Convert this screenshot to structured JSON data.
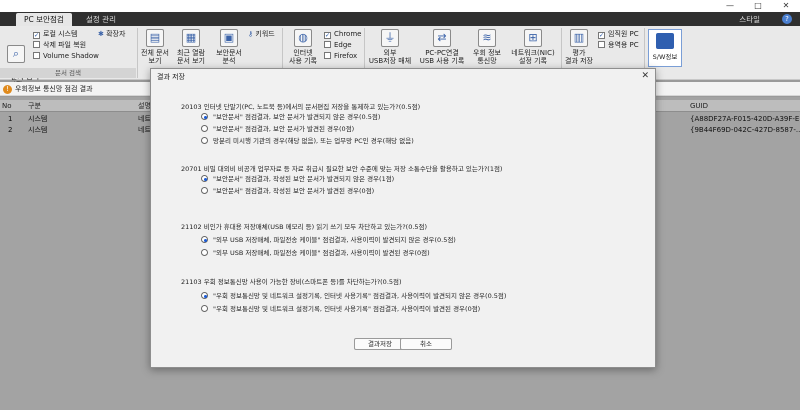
{
  "window": {
    "minimize": "—",
    "maximize": "□",
    "close": "✕"
  },
  "tabs": [
    {
      "label": "PC 보안점검"
    },
    {
      "label": "설정 관리"
    }
  ],
  "style_label": "스타일",
  "help_icon": "?",
  "ribbon": {
    "check_start": "문서 검색\n시작",
    "options": [
      {
        "label": "로컬 시스템",
        "checked": true
      },
      {
        "label": "삭제 파일 복원",
        "checked": false
      },
      {
        "label": "Volume Shadow",
        "checked": false
      }
    ],
    "extension": "확장자",
    "group_doc_search": "문서 검색",
    "full_doc": "전체 문서\n보기",
    "recent_doc": "최근 열람\n문서 보기",
    "secure_doc": "보안문서\n분석",
    "keyword": "키워드",
    "internet_usage": "인터넷\n사용 기록",
    "browsers": [
      {
        "label": "Chrome",
        "checked": true
      },
      {
        "label": "Edge",
        "checked": false
      },
      {
        "label": "Firefox",
        "checked": false
      }
    ],
    "external_usb": "외부\nUSB저장 매체",
    "pc_pc_link": "PC-PC연결\nUSB 사용 기록",
    "wireless": "우회 정보\n통신망",
    "network_nic": "네트워크(NIC)\n설정 기록",
    "eval_save": "평가\n결과 저장",
    "targets": [
      {
        "label": "임직원 PC",
        "checked": true
      },
      {
        "label": "용역용 PC",
        "checked": false
      }
    ],
    "sw_info": "S/W정보"
  },
  "infobar": "우회정보 통신망 점검 결과",
  "table": {
    "headers": [
      "No",
      "구분",
      "설명",
      "GUID"
    ],
    "rows": [
      [
        "1",
        "시스템",
        "네트",
        "{A88DF27A-F015-420D-A39F-E..."
      ],
      [
        "2",
        "시스템",
        "네트",
        "{9B44F69D-042C-427D-8587-..."
      ]
    ]
  },
  "modal": {
    "title": "결과 저장",
    "questions": [
      {
        "text": "20103 인터넷 단말기(PC, 노트북 등)에서의 문서편집 저장을 통제하고 있는가?(0.5점)",
        "options": [
          {
            "label": "\"보안문서\" 점검결과, 보안 문서가 발견되지 않은 경우(0.5점)",
            "selected": true
          },
          {
            "label": "\"보안문서\" 점검결과, 보안 문서가 발견된 경우(0점)",
            "selected": false
          },
          {
            "label": "망분리 미시행 기관의 경우(해당 없음), 또는 업무망 PC인 경우(해당 없음)",
            "selected": false
          }
        ]
      },
      {
        "text": "20701 비밀 대외비 비공개 업무자료 등 자료 취급시 필요한 보안 수준에 맞는 저장 소통수단을 활용하고 있는가?(1점)",
        "options": [
          {
            "label": "\"보안문서\" 점검결과, 작성된 보안 문서가 발견되지 않은 경우(1점)",
            "selected": true
          },
          {
            "label": "\"보안문서\" 점검결과, 작성된 보안 문서가 발견된 경우(0점)",
            "selected": false
          }
        ]
      },
      {
        "text": "21102 비인가 휴대용 저장매체(USB 메모리 등) 읽기 쓰기 모두 차단하고 있는가?(0.5점)",
        "options": [
          {
            "label": "\"외부 USB 저장매체, 파일전송 케이블\" 점검결과, 사용이력이 발견되지 않은 경우(0.5점)",
            "selected": true
          },
          {
            "label": "\"외부 USB 저장매체, 파일전송 케이블\" 점검결과, 사용이력이 발견된 경우(0점)",
            "selected": false
          }
        ]
      },
      {
        "text": "21103 우회 정보통신망 사용이 가능한 장비(스마트폰 등)를 차단하는가?(0.5점)",
        "options": [
          {
            "label": "\"우회 정보통신망 및 네트워크 설정기록, 인터넷 사용기록\" 점검결과, 사용이력이 발견되지 않은 경우(0.5점)",
            "selected": true
          },
          {
            "label": "\"우회 정보통신망 및 네트워크 설정기록, 인터넷 사용기록\" 점검결과, 사용이력이 발견된 경우(0점)",
            "selected": false
          }
        ]
      }
    ],
    "save_button": "결과저장",
    "cancel_button": "취소"
  }
}
